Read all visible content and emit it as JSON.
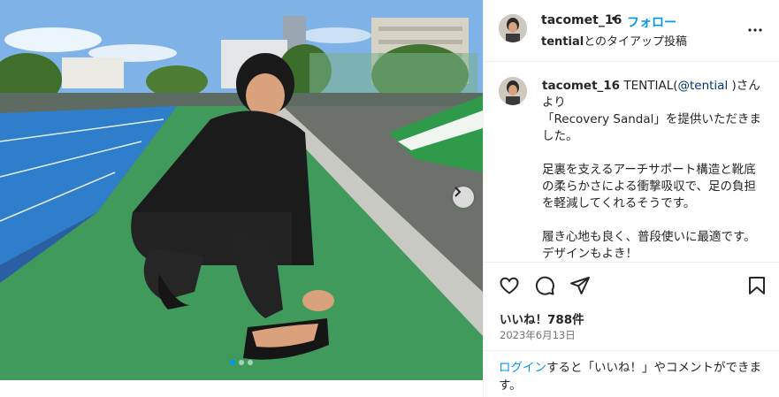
{
  "header": {
    "username": "tacomet_16",
    "separator": "•",
    "follow_label": "フォロー",
    "partner": "tential",
    "partnership_suffix": "とのタイアップ投稿"
  },
  "caption": {
    "username": "tacomet_16",
    "text_before_mention": " TENTIAL(",
    "mention": "@tential",
    "text_after_mention": " )さんより\n「Recovery Sandal」を提供いただきました。\n\n足裏を支えるアーチサポート構造と靴底の柔らかさによる衝撃吸収で、足の負担を軽減してくれるそうです。\n\n履き心地も良く、普段使いに最適です。\nデザインもよき！"
  },
  "actions": {
    "like_icon": "heart-icon",
    "comment_icon": "comment-icon",
    "share_icon": "send-icon",
    "save_icon": "bookmark-icon"
  },
  "likes": "いいね！788件",
  "date": "2023年6月13日",
  "login_prompt": {
    "link_label": "ログイン",
    "text": "すると「いいね！」やコメントができます。"
  },
  "carousel": {
    "total_slides": 3,
    "current_slide": 1,
    "accent": "#0095f6"
  },
  "colors": {
    "link_blue": "#0095f6",
    "mention_blue": "#00376b",
    "text": "#262626",
    "muted": "#737373"
  }
}
